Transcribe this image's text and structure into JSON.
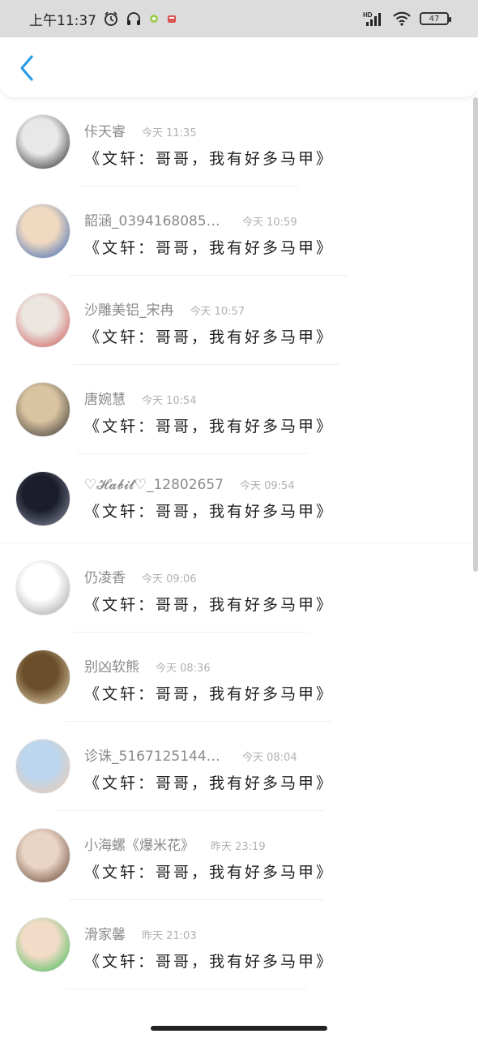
{
  "status_bar": {
    "time": "上午11:37",
    "network": "HD",
    "battery": "47"
  },
  "header": {
    "back_icon": "chevron-left-icon",
    "accent_color": "#2a9be6"
  },
  "comments": [
    {
      "username": "佧天睿",
      "time": "今天 11:35",
      "text": "《文轩：哥哥，我有好多马甲》",
      "avatar": "bw-girl-photo",
      "avatar_colors": [
        "#e8e8e8",
        "#1a1a1a"
      ]
    },
    {
      "username": "韶涵_039416808564…",
      "time": "今天 10:59",
      "text": "《文轩：哥哥，我有好多马甲》",
      "avatar": "kid-with-blue-shirt-photo",
      "avatar_colors": [
        "#f0d9c0",
        "#2a5fb8"
      ]
    },
    {
      "username": "沙雕美铝_宋冉",
      "time": "今天 10:57",
      "text": "《文轩：哥哥，我有好多马甲》",
      "avatar": "hello-kitty-pattern",
      "avatar_colors": [
        "#ece6e0",
        "#c94b4b"
      ]
    },
    {
      "username": "唐婉慧",
      "time": "今天 10:54",
      "text": "《文轩：哥哥，我有好多马甲》",
      "avatar": "sunset-silhouette-photo",
      "avatar_colors": [
        "#d9c3a0",
        "#2b2b2b"
      ]
    },
    {
      "username": "♡𝓗𝓪𝓫𝓲𝓽♡_12802657",
      "time": "今天 09:54",
      "text": "《文轩：哥哥，我有好多马甲》",
      "avatar": "night-sky-photo",
      "avatar_colors": [
        "#1b1e2a",
        "#8e93a8"
      ]
    },
    {
      "username": "仍凌香",
      "time": "今天 09:06",
      "text": "《文轩：哥哥，我有好多马甲》",
      "avatar": "cartoon-bunny-sketch",
      "avatar_colors": [
        "#ffffff",
        "#9a9a9a"
      ]
    },
    {
      "username": "别凶软熊",
      "time": "今天 08:36",
      "text": "《文轩：哥哥，我有好多马甲》",
      "avatar": "girl-ponytail-photo",
      "avatar_colors": [
        "#6b4f2a",
        "#f2e2c4"
      ]
    },
    {
      "username": "诊诛_516712514490…",
      "time": "今天 08:04",
      "text": "《文轩：哥哥，我有好多马甲》",
      "avatar": "anime-girl-illustration",
      "avatar_colors": [
        "#bcd6ef",
        "#f3c9a6"
      ]
    },
    {
      "username": "小海螺《爆米花》",
      "time": "昨天 23:19",
      "text": "《文轩：哥哥，我有好多马甲》",
      "avatar": "boy-portrait-photo",
      "avatar_colors": [
        "#ead4c4",
        "#5b3a2a"
      ]
    },
    {
      "username": "滑家馨",
      "time": "昨天 21:03",
      "text": "《文轩：哥哥，我有好多马甲》",
      "avatar": "girl-green-banner-photo",
      "avatar_colors": [
        "#f2dcc8",
        "#2fb84a"
      ]
    }
  ]
}
